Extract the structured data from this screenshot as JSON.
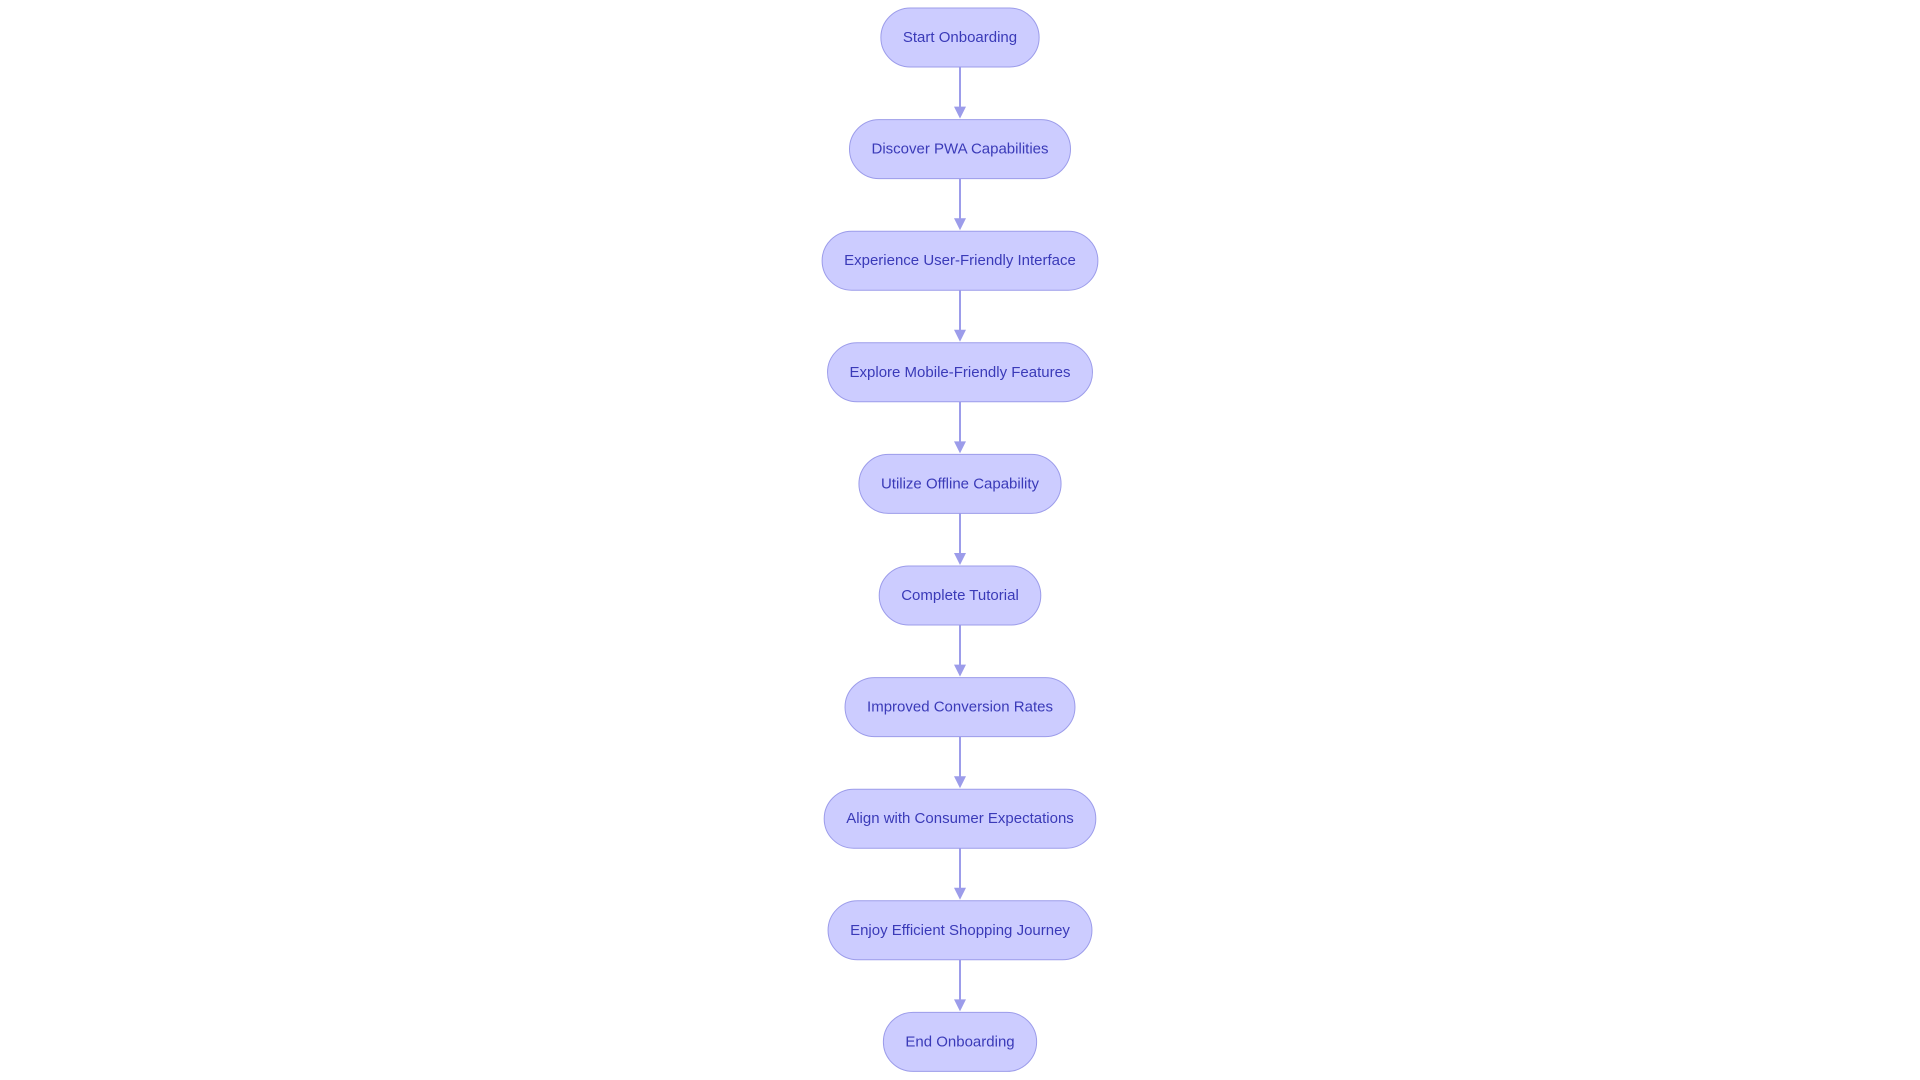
{
  "diagram": {
    "type": "flowchart",
    "direction": "top-to-bottom",
    "colors": {
      "node_fill": "#ccccff",
      "node_stroke": "#9c9cea",
      "node_text": "#3a3ab8",
      "edge": "#9c9cea",
      "background": "#ffffff"
    },
    "nodes": [
      {
        "id": "start",
        "label": "Start Onboarding"
      },
      {
        "id": "discover",
        "label": "Discover PWA Capabilities"
      },
      {
        "id": "experience",
        "label": "Experience User-Friendly Interface"
      },
      {
        "id": "explore",
        "label": "Explore Mobile-Friendly Features"
      },
      {
        "id": "utilize",
        "label": "Utilize Offline Capability"
      },
      {
        "id": "tutorial",
        "label": "Complete Tutorial"
      },
      {
        "id": "improved",
        "label": "Improved Conversion Rates"
      },
      {
        "id": "align",
        "label": "Align with Consumer Expectations"
      },
      {
        "id": "enjoy",
        "label": "Enjoy Efficient Shopping Journey"
      },
      {
        "id": "end",
        "label": "End Onboarding"
      }
    ],
    "edges": [
      {
        "from": "start",
        "to": "discover"
      },
      {
        "from": "discover",
        "to": "experience"
      },
      {
        "from": "experience",
        "to": "explore"
      },
      {
        "from": "explore",
        "to": "utilize"
      },
      {
        "from": "utilize",
        "to": "tutorial"
      },
      {
        "from": "tutorial",
        "to": "improved"
      },
      {
        "from": "improved",
        "to": "align"
      },
      {
        "from": "align",
        "to": "enjoy"
      },
      {
        "from": "enjoy",
        "to": "end"
      }
    ]
  }
}
